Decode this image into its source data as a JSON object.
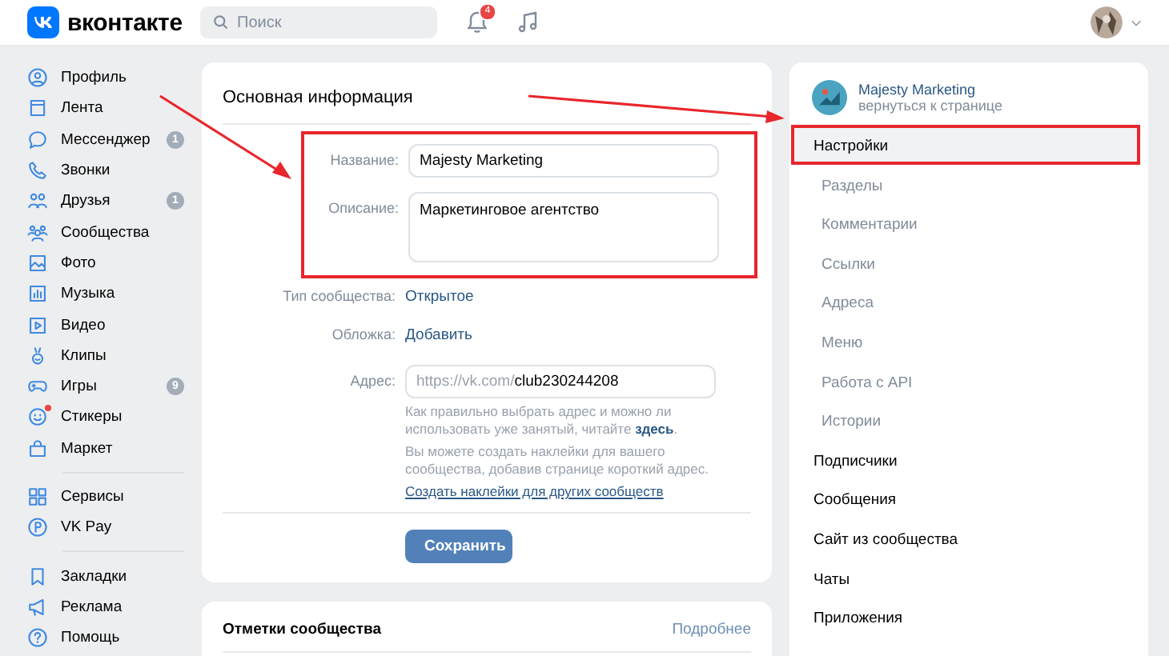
{
  "header": {
    "brand": "вконтакте",
    "search": {
      "placeholder": "Поиск"
    },
    "notifications_badge": "4"
  },
  "sidebar": {
    "groups": [
      [
        {
          "label": "Профиль"
        },
        {
          "label": "Лента"
        },
        {
          "label": "Мессенджер",
          "badge": "1"
        },
        {
          "label": "Звонки"
        },
        {
          "label": "Друзья",
          "badge": "1"
        },
        {
          "label": "Сообщества"
        },
        {
          "label": "Фото"
        },
        {
          "label": "Музыка"
        },
        {
          "label": "Видео"
        },
        {
          "label": "Клипы"
        },
        {
          "label": "Игры",
          "badge": "9"
        },
        {
          "label": "Стикеры",
          "dot": true
        },
        {
          "label": "Маркет"
        }
      ],
      [
        {
          "label": "Сервисы"
        },
        {
          "label": "VK Pay"
        }
      ],
      [
        {
          "label": "Закладки"
        },
        {
          "label": "Реклама"
        },
        {
          "label": "Помощь"
        }
      ]
    ]
  },
  "main_card": {
    "title": "Основная информация",
    "highlighted": true,
    "name": {
      "label": "Название:",
      "value": "Majesty Marketing"
    },
    "description": {
      "label": "Описание:",
      "value": "Маркетинговое агентство"
    },
    "type": {
      "label": "Тип сообщества:",
      "value": "Открытое"
    },
    "cover": {
      "label": "Обложка:",
      "value": "Добавить"
    },
    "address": {
      "label": "Адрес:",
      "prefix": "https://vk.com/",
      "value": "club230244208"
    },
    "help_1": {
      "text": "Как правильно выбрать адрес и можно ли использовать уже занятый, читайте ",
      "link": "здесь",
      "end": "."
    },
    "help_2": "Вы можете создать наклейки для вашего сообщества, добавив странице короткий адрес.",
    "help_link": "Создать наклейки для других сообществ",
    "save": "Сохранить"
  },
  "marks_card": {
    "title": "Отметки сообщества",
    "more": "Подробнее"
  },
  "settings_nav": {
    "community": "Majesty Marketing",
    "back": "вернуться к странице",
    "items": [
      {
        "label": "Настройки",
        "kind": "main",
        "selected": true,
        "highlighted": true
      },
      {
        "label": "Разделы",
        "kind": "sub",
        "selected": false
      },
      {
        "label": "Комментарии",
        "kind": "sub",
        "selected": false
      },
      {
        "label": "Ссылки",
        "kind": "sub",
        "selected": false
      },
      {
        "label": "Адреса",
        "kind": "sub",
        "selected": false
      },
      {
        "label": "Меню",
        "kind": "sub",
        "selected": false
      },
      {
        "label": "Работа с API",
        "kind": "sub",
        "selected": false
      },
      {
        "label": "Истории",
        "kind": "sub",
        "selected": false
      },
      {
        "label": "Подписчики",
        "kind": "main",
        "selected": false
      },
      {
        "label": "Сообщения",
        "kind": "main",
        "selected": false
      },
      {
        "label": "Сайт из сообщества",
        "kind": "main",
        "selected": false
      },
      {
        "label": "Чаты",
        "kind": "main",
        "selected": false
      },
      {
        "label": "Приложения",
        "kind": "main",
        "selected": false
      }
    ]
  }
}
